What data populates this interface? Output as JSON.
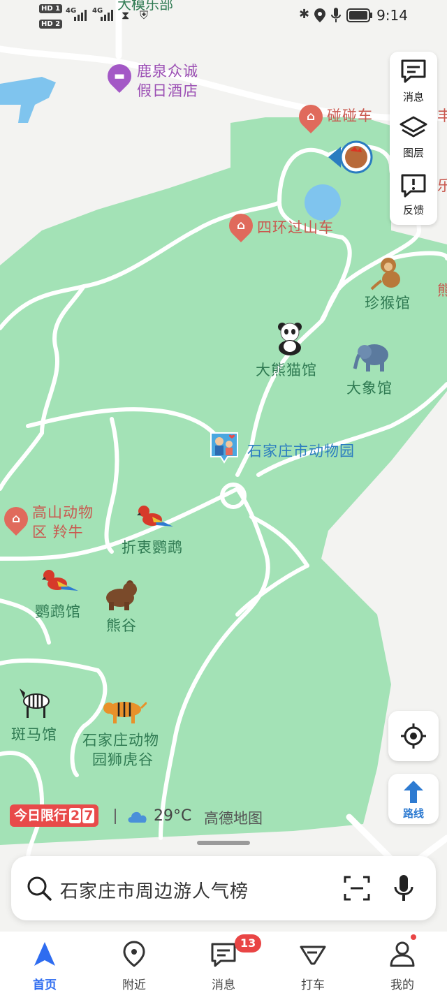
{
  "status_bar": {
    "time": "9:14",
    "hd1": "HD 1",
    "hd2": "HD 2",
    "net1": "4G",
    "net2": "4G",
    "top_cut_label": "大模乐部"
  },
  "map": {
    "hotel_label_line1": "鹿泉众诚",
    "hotel_label_line2": "假日酒店",
    "bumper_car_label": "碰碰车",
    "edge_label_1": "丰",
    "edge_label_2": "乐",
    "edge_label_3": "熊",
    "ring_coaster_label": "四环过山车",
    "monkey_label": "珍猴馆",
    "panda_label": "大熊猫馆",
    "elephant_label": "大象馆",
    "zoo_label": "石家庄市动物园",
    "alpine_label_line1": "高山动物",
    "alpine_label_line2": "区 羚牛",
    "parrot_small_label": "折衷鹦鹉",
    "parrot_house_label": "鹦鹉馆",
    "bear_label": "熊谷",
    "zebra_label": "斑马馆",
    "tiger_label_line1": "石家庄动物",
    "tiger_label_line2": "园狮虎谷",
    "colors": {
      "park": "#a3e2b6",
      "road": "#ffffff",
      "background": "#f3f3f1",
      "water": "#7fc4ee"
    }
  },
  "right_panel": {
    "message": "消息",
    "layers": "图层",
    "feedback": "反馈"
  },
  "route_button": "路线",
  "info_bar": {
    "restriction_label": "今日限行",
    "restriction_num1": "2",
    "restriction_num2": "7",
    "temperature": "29°C",
    "brand": "高德地图"
  },
  "search": {
    "placeholder": "石家庄市周边游人气榜"
  },
  "tabs": [
    {
      "label": "首页",
      "icon": "navigation-arrow-icon",
      "active": true
    },
    {
      "label": "附近",
      "icon": "location-pin-icon"
    },
    {
      "label": "消息",
      "icon": "message-icon",
      "badge": "13"
    },
    {
      "label": "打车",
      "icon": "taxi-icon"
    },
    {
      "label": "我的",
      "icon": "person-icon"
    }
  ]
}
